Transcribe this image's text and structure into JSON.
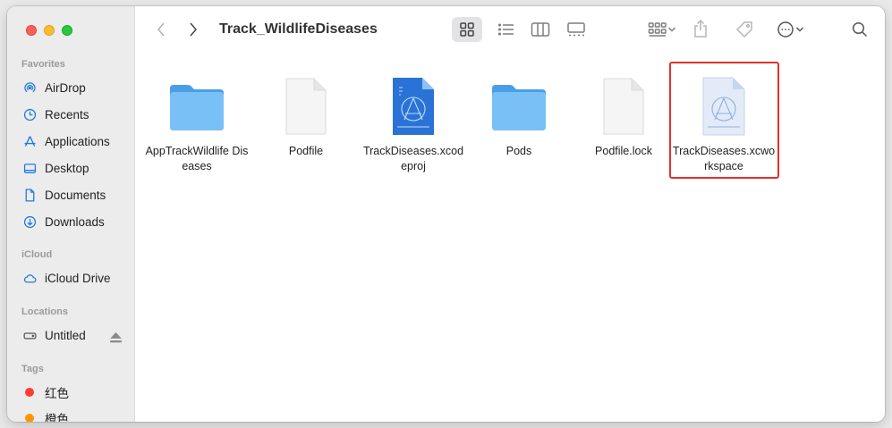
{
  "window": {
    "title": "Track_WildlifeDiseases"
  },
  "sidebar": {
    "favorites_header": "Favorites",
    "favorites": [
      {
        "label": "AirDrop",
        "icon": "airdrop-icon"
      },
      {
        "label": "Recents",
        "icon": "clock-icon"
      },
      {
        "label": "Applications",
        "icon": "applications-icon"
      },
      {
        "label": "Desktop",
        "icon": "desktop-icon"
      },
      {
        "label": "Documents",
        "icon": "document-icon"
      },
      {
        "label": "Downloads",
        "icon": "download-icon"
      }
    ],
    "icloud_header": "iCloud",
    "icloud": [
      {
        "label": "iCloud Drive",
        "icon": "cloud-icon"
      }
    ],
    "locations_header": "Locations",
    "locations": [
      {
        "label": "Untitled",
        "icon": "drive-icon"
      }
    ],
    "tags_header": "Tags",
    "tags": [
      {
        "label": "红色",
        "color": "#ff3b30"
      },
      {
        "label": "橙色",
        "color": "#ff9500"
      }
    ]
  },
  "files": [
    {
      "name": "AppTrackWildlife Diseases",
      "kind": "folder"
    },
    {
      "name": "Podfile",
      "kind": "document"
    },
    {
      "name": "TrackDiseases.xcodeproj",
      "kind": "xcodeproj"
    },
    {
      "name": "Pods",
      "kind": "folder"
    },
    {
      "name": "Podfile.lock",
      "kind": "document"
    },
    {
      "name": "TrackDiseases.xcworkspace",
      "kind": "xcworkspace",
      "highlighted": true
    }
  ],
  "colors": {
    "highlight": "#e0312d",
    "folder": "#5eb1ef",
    "accent": "#1f7ae0"
  }
}
